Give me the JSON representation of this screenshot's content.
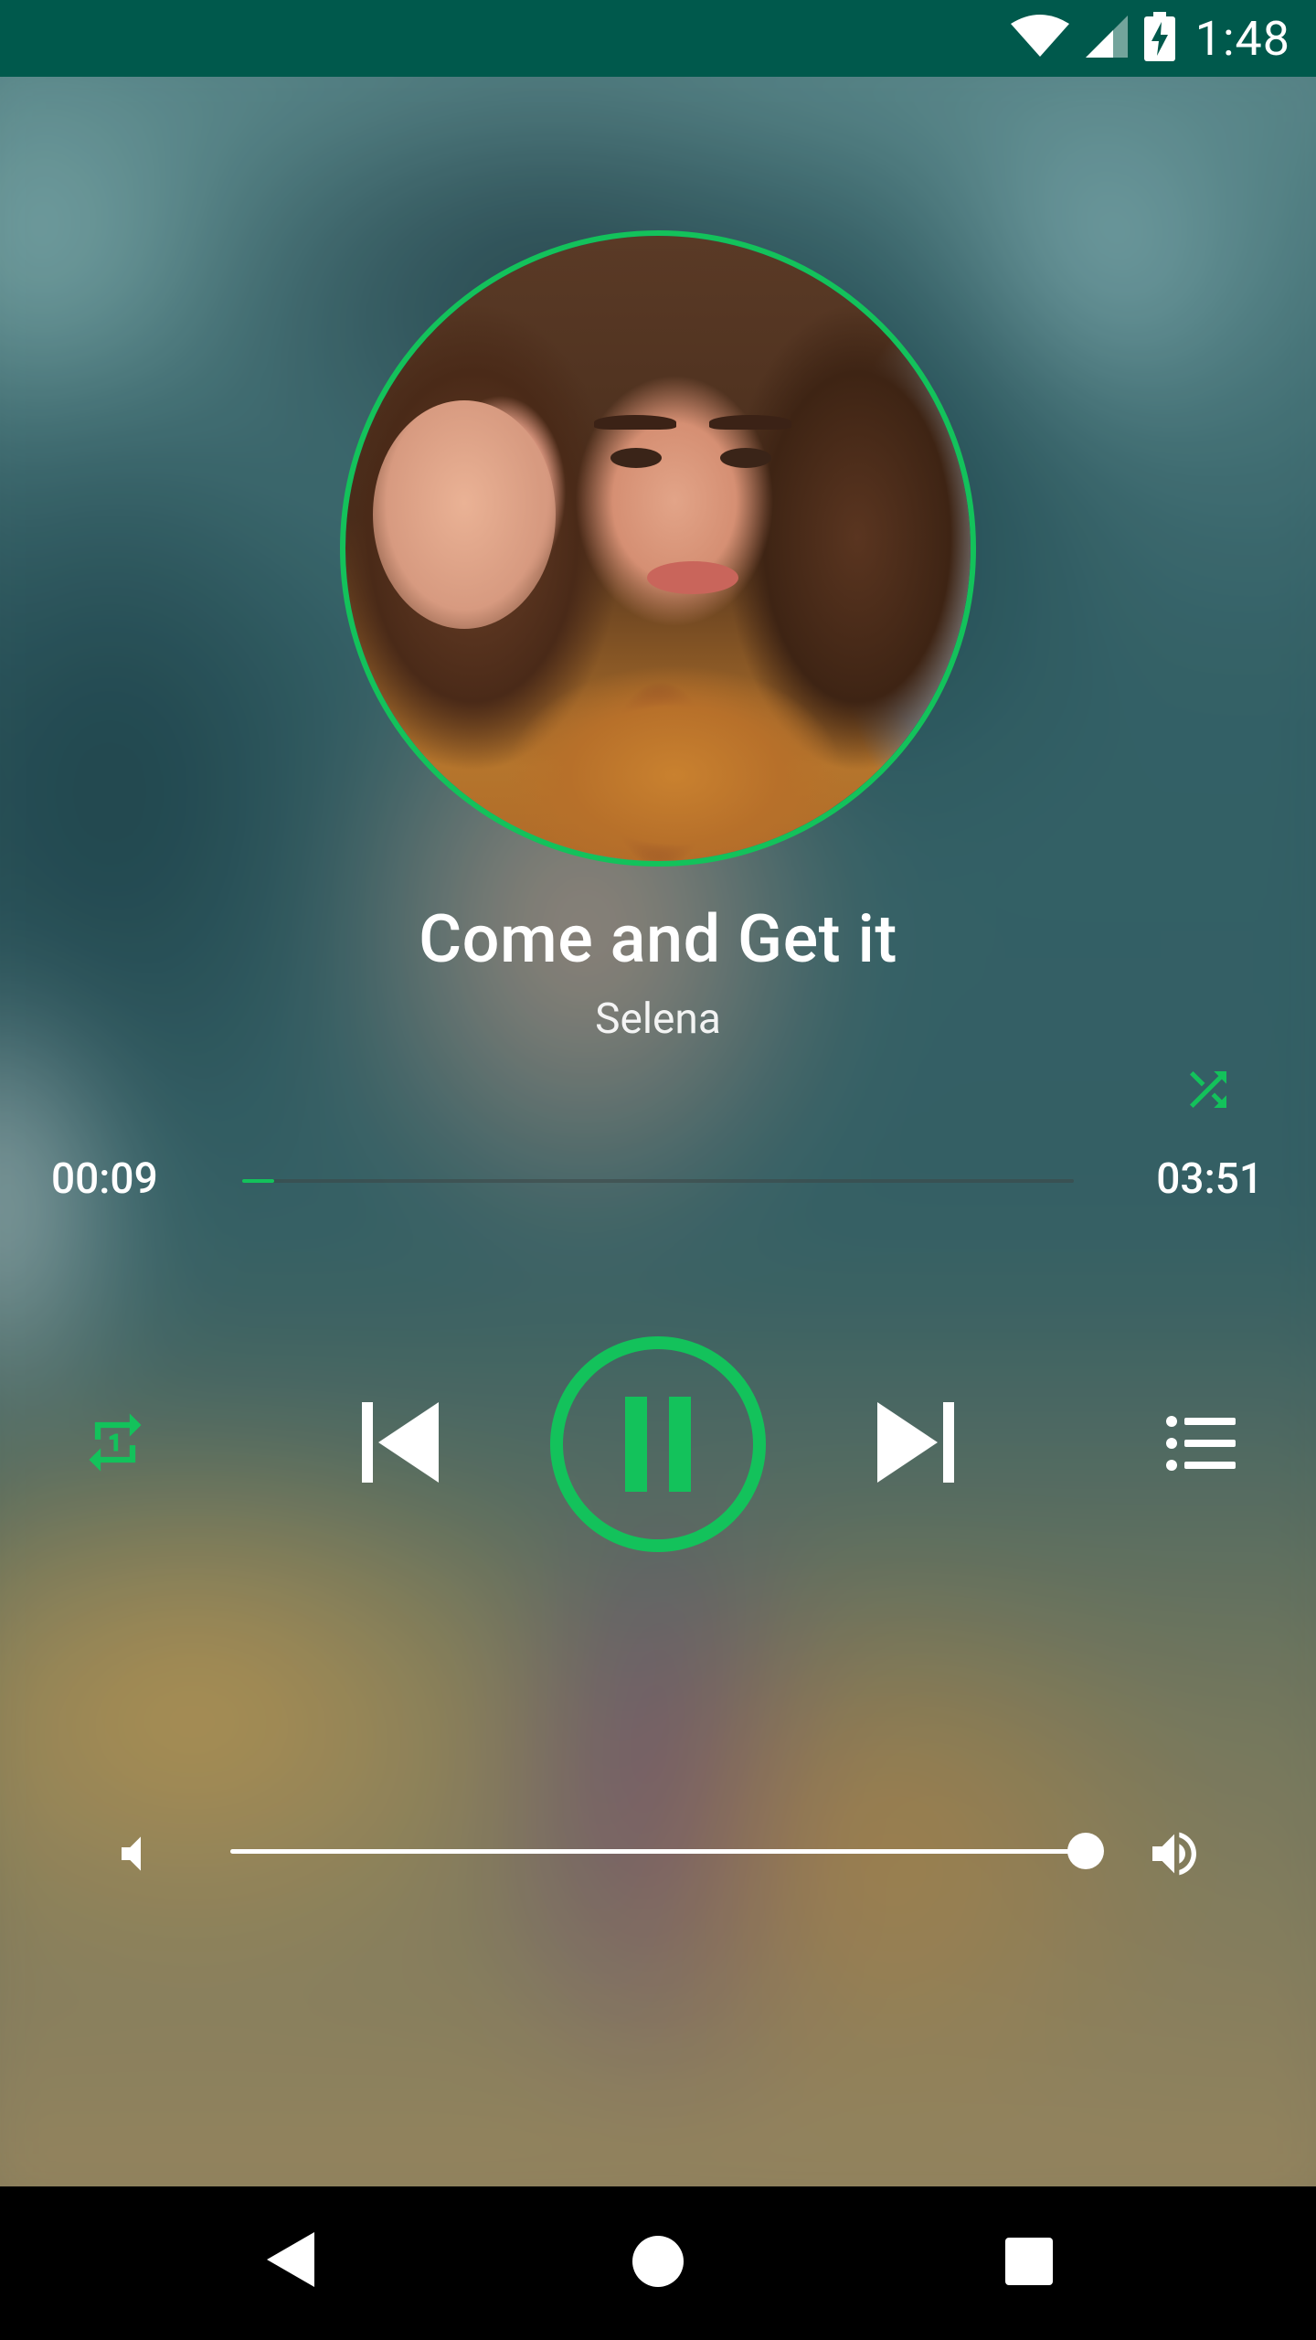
{
  "status_bar": {
    "time": "1:48",
    "icons": [
      "wifi-icon",
      "cell-signal-icon",
      "battery-charging-icon"
    ]
  },
  "track": {
    "title": "Come and Get it",
    "artist": "Selena"
  },
  "progress": {
    "elapsed": "00:09",
    "total": "03:51",
    "fraction": 0.039
  },
  "volume": {
    "level": 1.0
  },
  "controls": [
    "repeat-one-icon",
    "previous-icon",
    "pause-icon",
    "next-icon",
    "queue-icon",
    "shuffle-icon"
  ],
  "colors": {
    "accent": "#13c25b",
    "status_bar": "#00594c",
    "nav_bar": "#000000",
    "text": "#ffffff"
  }
}
